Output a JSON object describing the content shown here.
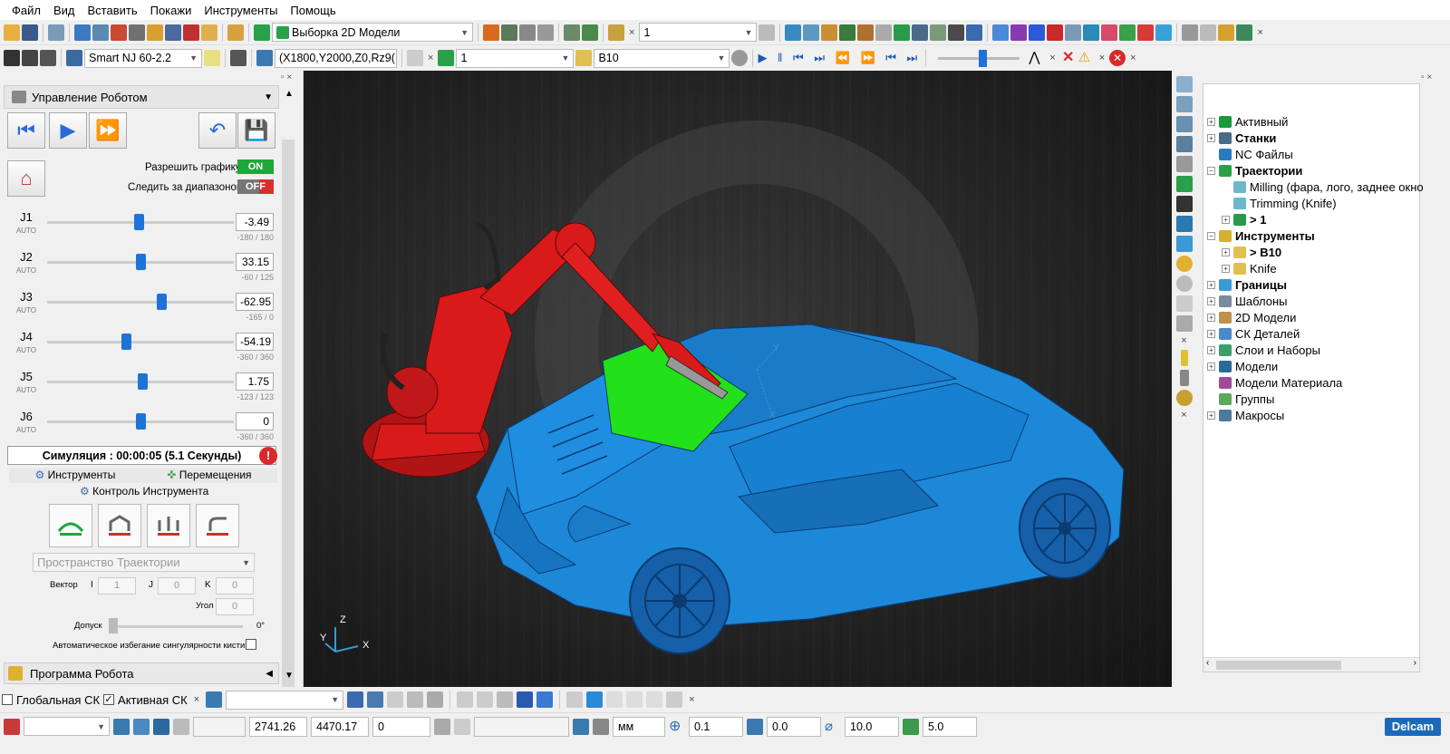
{
  "menu": [
    "Файл",
    "Вид",
    "Вставить",
    "Покажи",
    "Инструменты",
    "Помощь"
  ],
  "toolbar1": {
    "pattern_combo": "Выборка 2D Модели",
    "pattern_num": "1"
  },
  "toolbar2": {
    "machine": "Smart NJ 60-2.2",
    "position": "(X1800,Y2000,Z0,Rz9(",
    "toolpath_num": "1",
    "tool": "B10"
  },
  "robot_panel": {
    "title": "Управление Роботом",
    "allow_graphics_label": "Разрешить графику",
    "allow_graphics_state": "ON",
    "follow_range_label": "Следить за диапазоном",
    "follow_range_state": "OFF",
    "joints": [
      {
        "name": "J1",
        "mode": "AUTO",
        "value": "-3.49",
        "range": "-180 / 180",
        "pos": 0.49
      },
      {
        "name": "J2",
        "mode": "AUTO",
        "value": "33.15",
        "range": "-60 / 125",
        "pos": 0.5
      },
      {
        "name": "J3",
        "mode": "AUTO",
        "value": "-62.95",
        "range": "-165 / 0",
        "pos": 0.61
      },
      {
        "name": "J4",
        "mode": "AUTO",
        "value": "-54.19",
        "range": "-360 / 360",
        "pos": 0.42
      },
      {
        "name": "J5",
        "mode": "AUTO",
        "value": "1.75",
        "range": "-123 / 123",
        "pos": 0.51
      },
      {
        "name": "J6",
        "mode": "AUTO",
        "value": "0",
        "range": "-360 / 360",
        "pos": 0.5
      }
    ],
    "simulation": "Симуляция :   00:00:05  (5.1 Секунды)",
    "tab_tools": "Инструменты",
    "tab_moves": "Перемещения",
    "tool_control": "Контроль Инструмента",
    "space_combo": "Пространство Траектории",
    "vector_label": "Вектор",
    "i_label": "I",
    "i_val": "1",
    "j_label": "J",
    "j_val": "0",
    "k_label": "K",
    "k_val": "0",
    "angle_label": "Угол",
    "angle_val": "0",
    "tolerance_label": "Допуск",
    "tolerance_val": "0°",
    "singularity_label": "Автоматическое избегание сингулярности кисти",
    "program_label": "Программа Робота"
  },
  "explorer": {
    "items": [
      {
        "label": "Активный",
        "bold": false,
        "level": 0,
        "expander": "+",
        "color": "#1a9a3a"
      },
      {
        "label": "Станки",
        "bold": true,
        "level": 0,
        "expander": "+",
        "color": "#4a6a8a"
      },
      {
        "label": "NC Файлы",
        "bold": false,
        "level": 0,
        "expander": "",
        "color": "#2a7abf"
      },
      {
        "label": "Траектории",
        "bold": true,
        "level": 0,
        "expander": "−",
        "color": "#2aa04a"
      },
      {
        "label": "Milling (фара, лого, заднее окно",
        "bold": false,
        "level": 1,
        "expander": "",
        "color": "#6fb6c8"
      },
      {
        "label": "Trimming (Knife)",
        "bold": false,
        "level": 1,
        "expander": "",
        "color": "#6fb6c8"
      },
      {
        "label": "> 1",
        "bold": true,
        "level": 1,
        "expander": "+",
        "color": "#2a9a4a"
      },
      {
        "label": "Инструменты",
        "bold": true,
        "level": 0,
        "expander": "−",
        "color": "#d8b030"
      },
      {
        "label": "> B10",
        "bold": true,
        "level": 1,
        "expander": "+",
        "color": "#e0c050"
      },
      {
        "label": "Knife",
        "bold": false,
        "level": 1,
        "expander": "+",
        "color": "#e0c050"
      },
      {
        "label": "Границы",
        "bold": true,
        "level": 0,
        "expander": "+",
        "color": "#3a9ad8"
      },
      {
        "label": "Шаблоны",
        "bold": false,
        "level": 0,
        "expander": "+",
        "color": "#7a8a9a"
      },
      {
        "label": "2D Модели",
        "bold": false,
        "level": 0,
        "expander": "+",
        "color": "#c09050"
      },
      {
        "label": "СК Деталей",
        "bold": false,
        "level": 0,
        "expander": "+",
        "color": "#4a8ac8"
      },
      {
        "label": "Слои и Наборы",
        "bold": false,
        "level": 0,
        "expander": "+",
        "color": "#3aa06a"
      },
      {
        "label": "Модели",
        "bold": false,
        "level": 0,
        "expander": "+",
        "color": "#2a6a9a"
      },
      {
        "label": "Модели Материала",
        "bold": false,
        "level": 0,
        "expander": "",
        "color": "#a04a9a"
      },
      {
        "label": "Группы",
        "bold": false,
        "level": 0,
        "expander": "",
        "color": "#5aaa5a"
      },
      {
        "label": "Макросы",
        "bold": false,
        "level": 0,
        "expander": "+",
        "color": "#4a7a9a"
      }
    ]
  },
  "bottom": {
    "global_cs": "Глобальная СК",
    "active_cs": "Активная СК",
    "x": "2741.26",
    "y": "4470.17",
    "z": "0",
    "units": "мм",
    "tol1": "0.1",
    "tol2": "0.0",
    "tol3": "10.0",
    "tol4": "5.0",
    "brand": "Delcam"
  },
  "viewport": {
    "axis_x": "X",
    "axis_y": "Y",
    "axis_z": "Z"
  },
  "colors": {
    "car": "#1e88d8",
    "robot": "#d81a1a",
    "glass": "#22e01a"
  }
}
